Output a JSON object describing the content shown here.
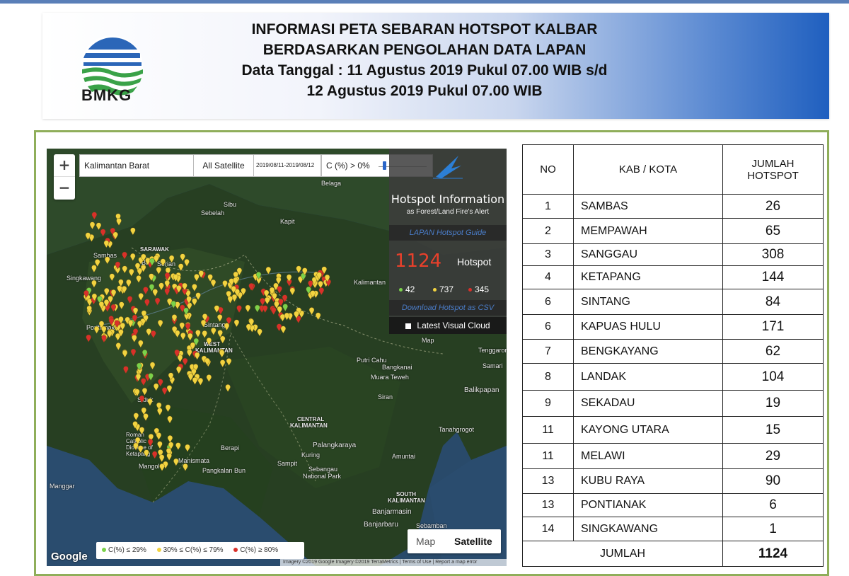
{
  "header": {
    "logo_text": "BMKG",
    "title_lines": [
      "INFORMASI PETA SEBARAN HOTSPOT KALBAR",
      "BERDASARKAN PENGOLAHAN DATA LAPAN",
      "Data Tanggal : 11 Agustus 2019 Pukul 07.00 WIB s/d",
      "12 Agustus 2019 Pukul 07.00 WIB"
    ]
  },
  "map": {
    "region_select": "Kalimantan Barat",
    "satellite_select": "All Satellite",
    "date_range": "2019/08/11-2019/08/12",
    "confidence_filter": "C (%) > 0%",
    "panel": {
      "title": "Hotspot Information",
      "subtitle": "as Forest/Land Fire's Alert",
      "guide_link": "LAPAN Hotspot Guide",
      "count": "1124",
      "count_label": "Hotspot",
      "low": "42",
      "medium": "737",
      "high": "345",
      "download_link": "Download Hotspot as CSV",
      "cloud_toggle": "Latest Visual Cloud"
    },
    "map_button": "Map",
    "satellite_button": "Satellite",
    "legend": {
      "low": "C(%) ≤ 29%",
      "medium": "30% ≤ C(%) ≤ 79%",
      "high": "C(%) ≥ 80%"
    },
    "google_label": "Google",
    "attribution": "Imagery ©2019 Google Imagery ©2019 TerraMetrics | Terms of Use | Report a map error",
    "places": {
      "belaga": "Belaga",
      "sibu": "Sibu",
      "sebelah": "Sebelah",
      "kapit": "Kapit",
      "sarawak": "SARAWAK",
      "serian": "Serian",
      "bau": "Bau",
      "singkawang": "Singkawang",
      "sambas": "Sambas",
      "pontianak": "Pontianak",
      "sintang": "Sintang",
      "west_kalimantan_1": "WEST",
      "west_kalimantan_2": "KALIMANTAN",
      "kalimantan": "Kalimantan",
      "map_label": "Map",
      "tenggarong": "Tenggarong",
      "samarinda": "Samari",
      "putri_cahu": "Putri Cahu",
      "bangkanai": "Bangkanai",
      "muara_teweh": "Muara Teweh",
      "balikpapan": "Balikpapan",
      "siran": "Siran",
      "siduk": "Siduk",
      "central_kalimantan_1": "CENTRAL",
      "central_kalimantan_2": "KALIMANTAN",
      "tanahgrogot": "Tanahgrogot",
      "berapi": "Berapi",
      "palangkaraya": "Palangkaraya",
      "kuring": "Kuring",
      "sampit": "Sampit",
      "amuntai": "Amuntai",
      "sebangau_1": "Sebangau",
      "sebangau_2": "National Park",
      "roman_1": "Roman",
      "roman_2": "Catholic",
      "roman_3": "Diocese of",
      "roman_4": "Ketapang",
      "mangol": "Mangol",
      "manismata": "Manismata",
      "pangkalan_bun": "Pangkalan Bun",
      "manggar": "Manggar",
      "south_kalimantan_1": "SOUTH",
      "south_kalimantan_2": "KALIMANTAN",
      "banjarmasin": "Banjarmasin",
      "banjarbaru": "Banjarbaru",
      "sebamban": "Sebamban"
    }
  },
  "table": {
    "headers": {
      "no": "NO",
      "kab": "KAB / KOTA",
      "jumlah_1": "JUMLAH",
      "jumlah_2": "HOTSPOT"
    },
    "rows": [
      {
        "no": "1",
        "kab": "SAMBAS",
        "jumlah": "26"
      },
      {
        "no": "2",
        "kab": "MEMPAWAH",
        "jumlah": "65"
      },
      {
        "no": "3",
        "kab": "SANGGAU",
        "jumlah": "308"
      },
      {
        "no": "4",
        "kab": "KETAPANG",
        "jumlah": "144"
      },
      {
        "no": "6",
        "kab": "SINTANG",
        "jumlah": "84"
      },
      {
        "no": "6",
        "kab": "KAPUAS HULU",
        "jumlah": "171"
      },
      {
        "no": "7",
        "kab": "BENGKAYANG",
        "jumlah": "62"
      },
      {
        "no": "8",
        "kab": "LANDAK",
        "jumlah": "104"
      },
      {
        "no": "9",
        "kab": "SEKADAU",
        "jumlah": "19"
      },
      {
        "no": "11",
        "kab": "KAYONG UTARA",
        "jumlah": "15"
      },
      {
        "no": "11",
        "kab": "MELAWI",
        "jumlah": "29"
      },
      {
        "no": "13",
        "kab": "KUBU RAYA",
        "jumlah": "90"
      },
      {
        "no": "13",
        "kab": "PONTIANAK",
        "jumlah": "6"
      },
      {
        "no": "14",
        "kab": "SINGKAWANG",
        "jumlah": "1"
      }
    ],
    "total_label": "JUMLAH",
    "total_value": "1124"
  },
  "colors": {
    "low": "#7bd24b",
    "medium": "#f2d340",
    "high": "#d9302a",
    "frame_border": "#8fae5a",
    "banner_accent": "#1f5fbf"
  }
}
